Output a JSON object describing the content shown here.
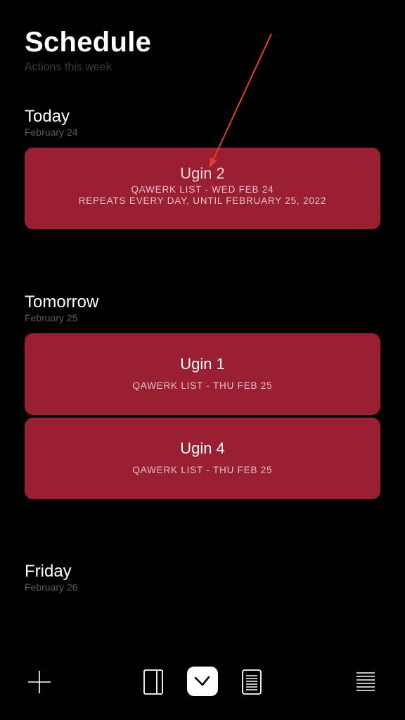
{
  "header": {
    "title": "Schedule",
    "subtitle": "Actions this week"
  },
  "sections": [
    {
      "title": "Today",
      "date": "February 24",
      "cards": [
        {
          "title": "Ugin 2",
          "meta": "QAWERK LIST - WED FEB 24",
          "meta2": "REPEATS EVERY DAY, UNTIL FEBRUARY 25, 2022"
        }
      ]
    },
    {
      "title": "Tomorrow",
      "date": "February 25",
      "cards": [
        {
          "title": "Ugin 1",
          "meta": "QAWERK LIST - THU FEB 25"
        },
        {
          "title": "Ugin 4",
          "meta": "QAWERK LIST - THU FEB 25"
        }
      ]
    },
    {
      "title": "Friday",
      "date": "February 26",
      "cards": []
    }
  ],
  "colors": {
    "background": "#000000",
    "card": "#9a1f33",
    "annotation_arrow": "#e0402e"
  },
  "tabbar": {
    "icons": [
      "plus-icon",
      "panel-icon",
      "clock-icon",
      "list-document-icon",
      "menu-lines-icon"
    ],
    "active": "clock-icon"
  }
}
